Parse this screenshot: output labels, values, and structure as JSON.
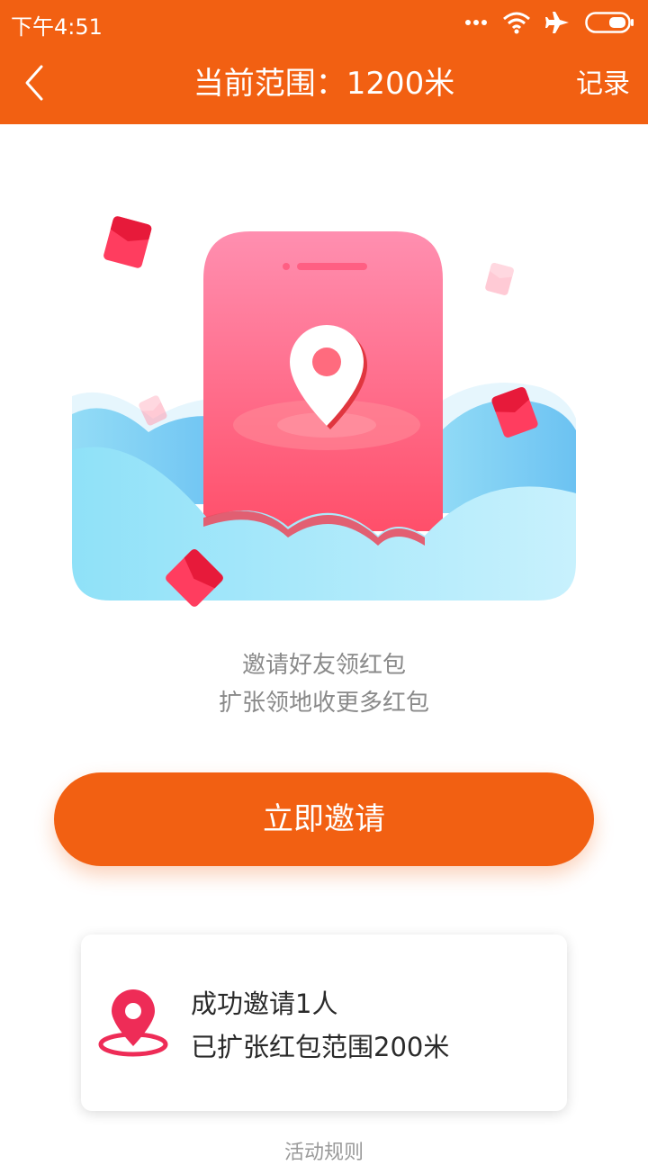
{
  "status_bar": {
    "time": "下午4:51",
    "icons": [
      "more-dots-icon",
      "wifi-icon",
      "airplane-icon",
      "battery-icon"
    ]
  },
  "nav": {
    "back_icon": "chevron-left-icon",
    "title": "当前范围：1200米",
    "action_label": "记录"
  },
  "hero": {
    "illustration": "phone-location-pin-with-clouds-and-red-envelopes"
  },
  "promo": {
    "line1": "邀请好友领红包",
    "line2": "扩张领地收更多红包"
  },
  "invite_button": {
    "label": "立即邀请"
  },
  "stats_card": {
    "icon": "location-pin-icon",
    "line1": "成功邀请1人",
    "line2": "已扩张红包范围200米"
  },
  "rules_link": {
    "label": "活动规则"
  },
  "colors": {
    "brand": "#f26012",
    "accent_pink": "#ff4d6d",
    "text_muted": "#8a8a8a"
  }
}
